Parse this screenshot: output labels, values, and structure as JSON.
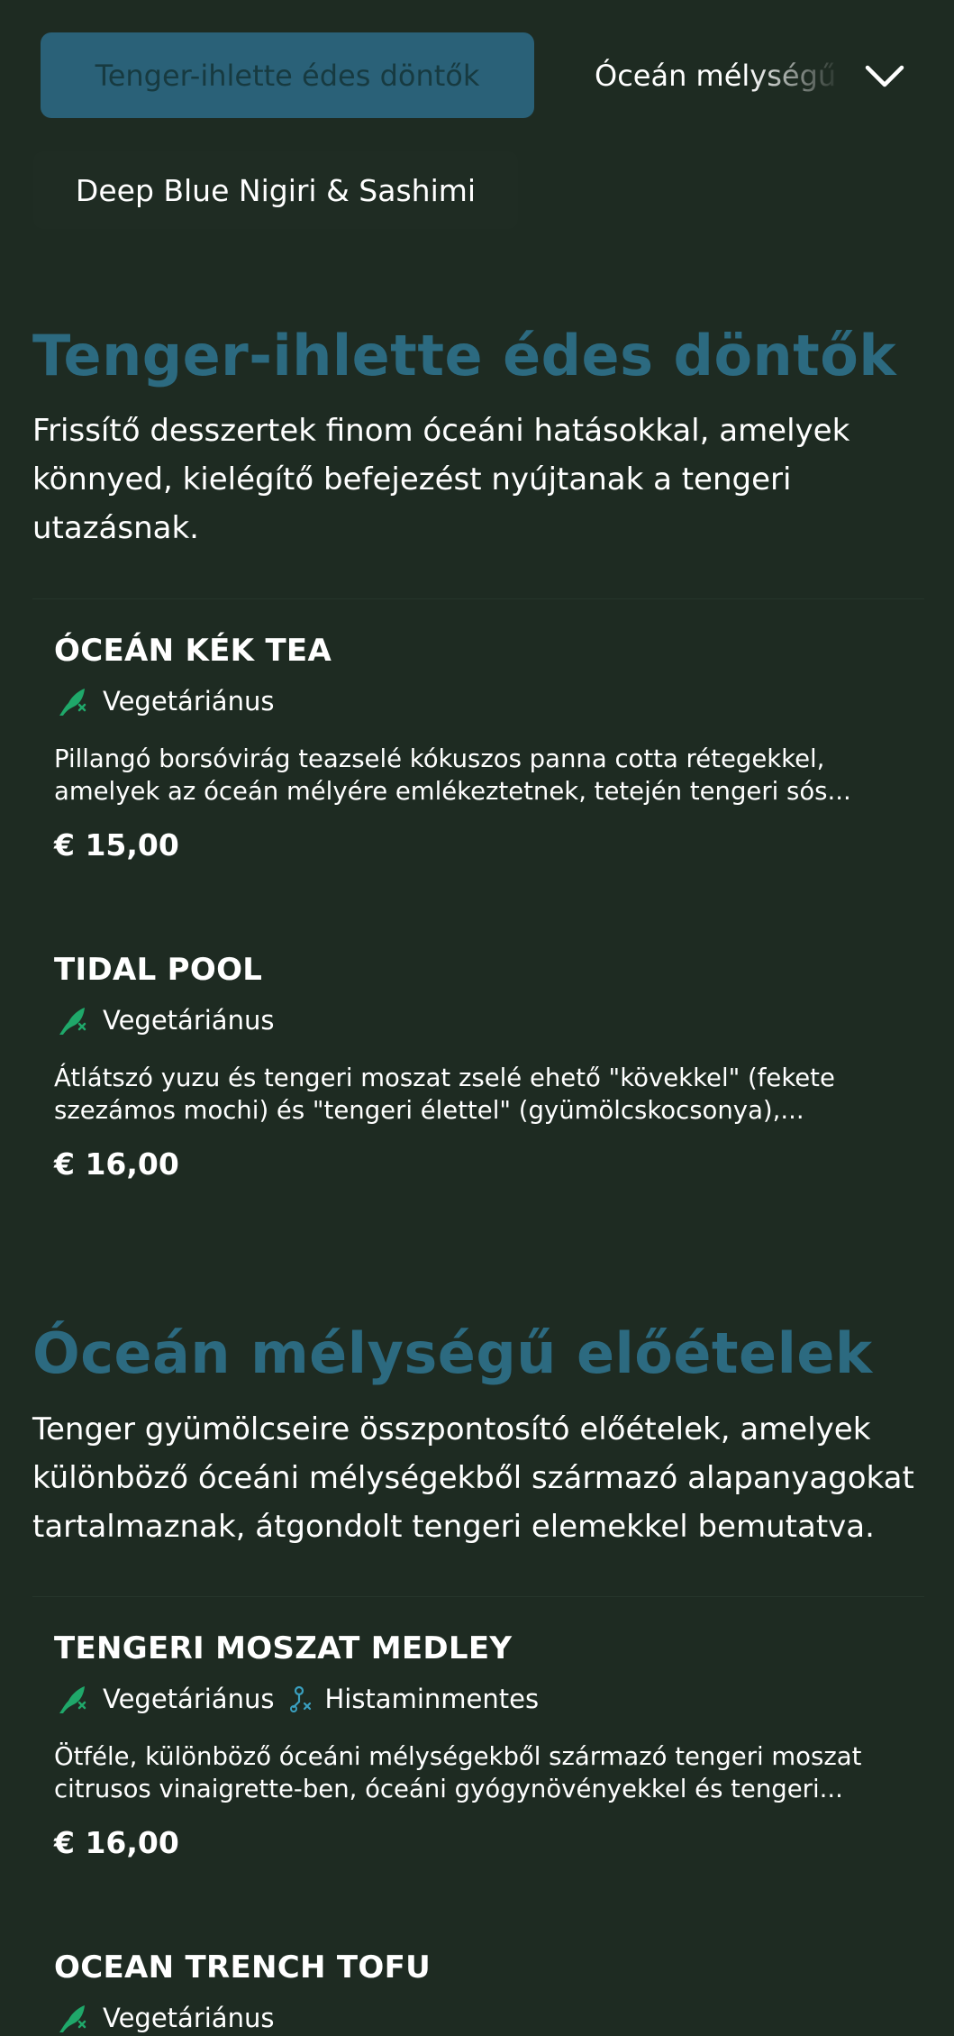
{
  "nav": {
    "active_tab": "Tenger-ihlette édes döntők",
    "next_tab": "Óceán mélységű előételek",
    "sub_tab": "Deep Blue Nigiri & Sashimi",
    "chevron_icon": "chevron-down-icon"
  },
  "sections": [
    {
      "title": "Tenger-ihlette édes döntők",
      "description": "Frissítő desszertek finom óceáni hatásokkal, amelyek könnyed, kielégítő befejezést nyújtanak a tengeri utazásnak.",
      "items": [
        {
          "name": "ÓCEÁN KÉK TEA",
          "tags": [
            "Vegetáriánus"
          ],
          "description": "Pillangó borsóvirág teazselé kókuszos panna cotta rétegekkel, amelyek az óceán mélyére emlékeztetnek, tetején tengeri sós...",
          "price": "€ 15,00"
        },
        {
          "name": "TIDAL POOL",
          "tags": [
            "Vegetáriánus"
          ],
          "description": "Átlátszó yuzu és tengeri moszat zselé ehető \"kövekkel\" (fekete szezámos mochi) és \"tengeri élettel\" (gyümölcskocsonya),...",
          "price": "€ 16,00"
        }
      ]
    },
    {
      "title": "Óceán mélységű előételek",
      "description": "Tenger gyümölcseire összpontosító előételek, amelyek különböző óceáni mélységekből származó alapanyagokat tartalmaznak, átgondolt tengeri elemekkel bemutatva.",
      "items": [
        {
          "name": "TENGERI MOSZAT MEDLEY",
          "tags": [
            "Vegetáriánus",
            "Histaminmentes"
          ],
          "description": "Ötféle, különböző óceáni mélységekből származó tengeri moszat citrusos vinaigrette-ben, óceáni gyógynövényekkel és tengeri...",
          "price": "€ 16,00"
        },
        {
          "name": "OCEAN TRENCH TOFU",
          "tags": [
            "Vegetáriánus"
          ]
        }
      ]
    }
  ],
  "colors": {
    "background": "#1e2b22",
    "accent": "#2c6a80",
    "active_tab_bg": "#2a6178",
    "vegetarian_icon": "#1fa86a",
    "histamine_icon": "#3aa0c0"
  },
  "icons": {
    "vegetarian": "vegetarian-leaf-icon",
    "histamine_free": "histamine-free-icon"
  }
}
